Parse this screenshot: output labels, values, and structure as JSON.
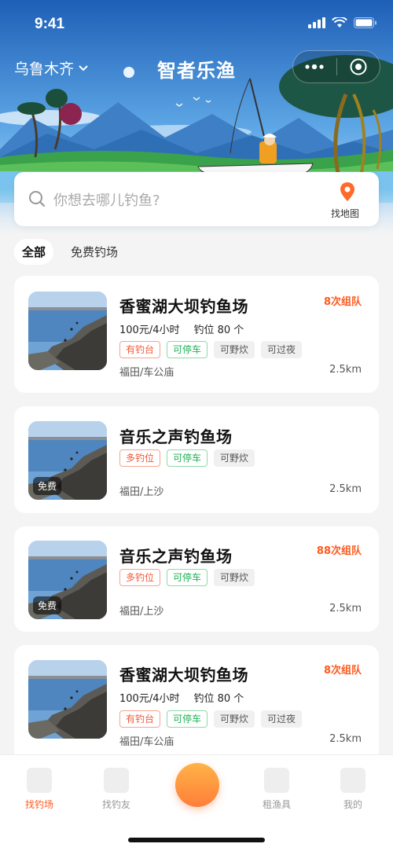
{
  "status": {
    "time": "9:41"
  },
  "nav": {
    "city": "乌鲁木齐",
    "title": "智者乐渔"
  },
  "search": {
    "placeholder": "你想去哪儿钓鱼?",
    "map_label": "找地图"
  },
  "filters": [
    "全部",
    "免费钓场"
  ],
  "cards": [
    {
      "title": "香蜜湖大坝钓鱼场",
      "team": "8次组队",
      "price": "100元/4小时",
      "spots": "钓位 80 个",
      "tags": [
        {
          "text": "有钓台",
          "style": "red"
        },
        {
          "text": "可停车",
          "style": "green"
        },
        {
          "text": "可野炊",
          "style": "gray"
        },
        {
          "text": "可过夜",
          "style": "gray"
        }
      ],
      "location": "福田/车公庙",
      "distance": "2.5km",
      "free": ""
    },
    {
      "title": "音乐之声钓鱼场",
      "team": "",
      "price": "",
      "spots": "",
      "tags": [
        {
          "text": "多钓位",
          "style": "red"
        },
        {
          "text": "可停车",
          "style": "green"
        },
        {
          "text": "可野炊",
          "style": "gray"
        }
      ],
      "location": "福田/上沙",
      "distance": "2.5km",
      "free": "免费"
    },
    {
      "title": "音乐之声钓鱼场",
      "team": "88次组队",
      "price": "",
      "spots": "",
      "tags": [
        {
          "text": "多钓位",
          "style": "red"
        },
        {
          "text": "可停车",
          "style": "green"
        },
        {
          "text": "可野炊",
          "style": "gray"
        }
      ],
      "location": "福田/上沙",
      "distance": "2.5km",
      "free": "免费"
    },
    {
      "title": "香蜜湖大坝钓鱼场",
      "team": "8次组队",
      "price": "100元/4小时",
      "spots": "钓位 80 个",
      "tags": [
        {
          "text": "有钓台",
          "style": "red"
        },
        {
          "text": "可停车",
          "style": "green"
        },
        {
          "text": "可野炊",
          "style": "gray"
        },
        {
          "text": "可过夜",
          "style": "gray"
        }
      ],
      "location": "福田/车公庙",
      "distance": "2.5km",
      "free": ""
    }
  ],
  "tabbar": {
    "items": [
      "找钓场",
      "找钓友",
      "",
      "租渔具",
      "我的"
    ],
    "active": "找钓场"
  },
  "colors": {
    "accent": "#ff5a1f",
    "tag_green": "#1db254",
    "tag_red": "#f05a3a"
  }
}
